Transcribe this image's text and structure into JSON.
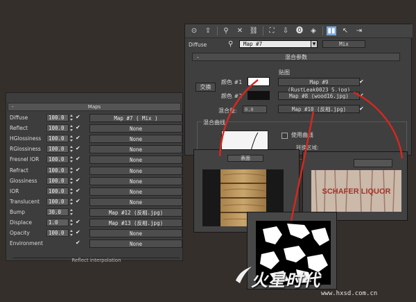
{
  "maps_rollout": {
    "title": "Maps",
    "collapse_symbol": "-",
    "footer": "Reflect interpolation",
    "rows": [
      {
        "label": "Diffuse",
        "amount": "100.0",
        "checked": true,
        "map": "Map #7     ( Mix )"
      },
      {
        "label": "Reflect",
        "amount": "100.0",
        "checked": true,
        "map": "None"
      },
      {
        "label": "HGlossiness",
        "amount": "100.0",
        "checked": true,
        "map": "None"
      },
      {
        "label": "RGlossiness",
        "amount": "100.0",
        "checked": true,
        "map": "None"
      },
      {
        "label": "Fresnel IOR",
        "amount": "100.0",
        "checked": true,
        "map": "None"
      },
      {
        "label": "Refract",
        "amount": "100.0",
        "checked": true,
        "map": "None"
      },
      {
        "label": "Glossiness",
        "amount": "100.0",
        "checked": true,
        "map": "None"
      },
      {
        "label": "IOR",
        "amount": "100.0",
        "checked": true,
        "map": "None"
      },
      {
        "label": "Translucent",
        "amount": "100.0",
        "checked": true,
        "map": "None"
      },
      {
        "label": "Bump",
        "amount": "30.0",
        "checked": false,
        "map": "Map #12 (反相.jpg)"
      },
      {
        "label": "Displace",
        "amount": "1.0",
        "checked": true,
        "map": "Map #13 (反相.jpg)"
      },
      {
        "label": "Opacity",
        "amount": "100.0",
        "checked": true,
        "map": "None"
      },
      {
        "label": "Environment",
        "amount": "",
        "checked": true,
        "map": "None"
      }
    ]
  },
  "mix_panel": {
    "slot_label": "Diffuse",
    "material_name": "Map #7",
    "material_type": "Mix",
    "rollout_title": "混合参数",
    "maps_header": "贴图",
    "swap_label": "交换",
    "color1_label": "颜色 #1",
    "color2_label": "颜色 #2",
    "mix_amount_label": "混合量:",
    "mix_amount_value": "0.0",
    "map1": "Map #9  (RustLeak0023_S.jpg)",
    "map2": "Map #8  (wood16.jpg)",
    "map3": "Map #10 (反相.jpg)",
    "curve_group_label": "混合曲线",
    "use_curve_label": "使用曲线",
    "transition_label": "转换区域:",
    "check_glyph": "✔",
    "colors": {
      "color1": "#ffffff",
      "color2": "#111111"
    }
  },
  "insets": {
    "wood_window_button": "表面",
    "rust_sign_text": "SCHAFER LIQUOR"
  },
  "watermark": {
    "logo": "火星时代",
    "url": "www.hxsd.com.cn"
  },
  "toolbar_icons": [
    "get-material-icon",
    "put-to-scene-icon",
    "assign-icon",
    "reset-icon",
    "copy-icon",
    "unique-icon",
    "put-library-icon",
    "material-id-icon",
    "show-map-icon",
    "show-end-result-icon",
    "go-parent-icon",
    "go-sibling-icon"
  ],
  "accent_colors": {
    "panel": "#3f3f3f",
    "connector": "#d4281f"
  }
}
